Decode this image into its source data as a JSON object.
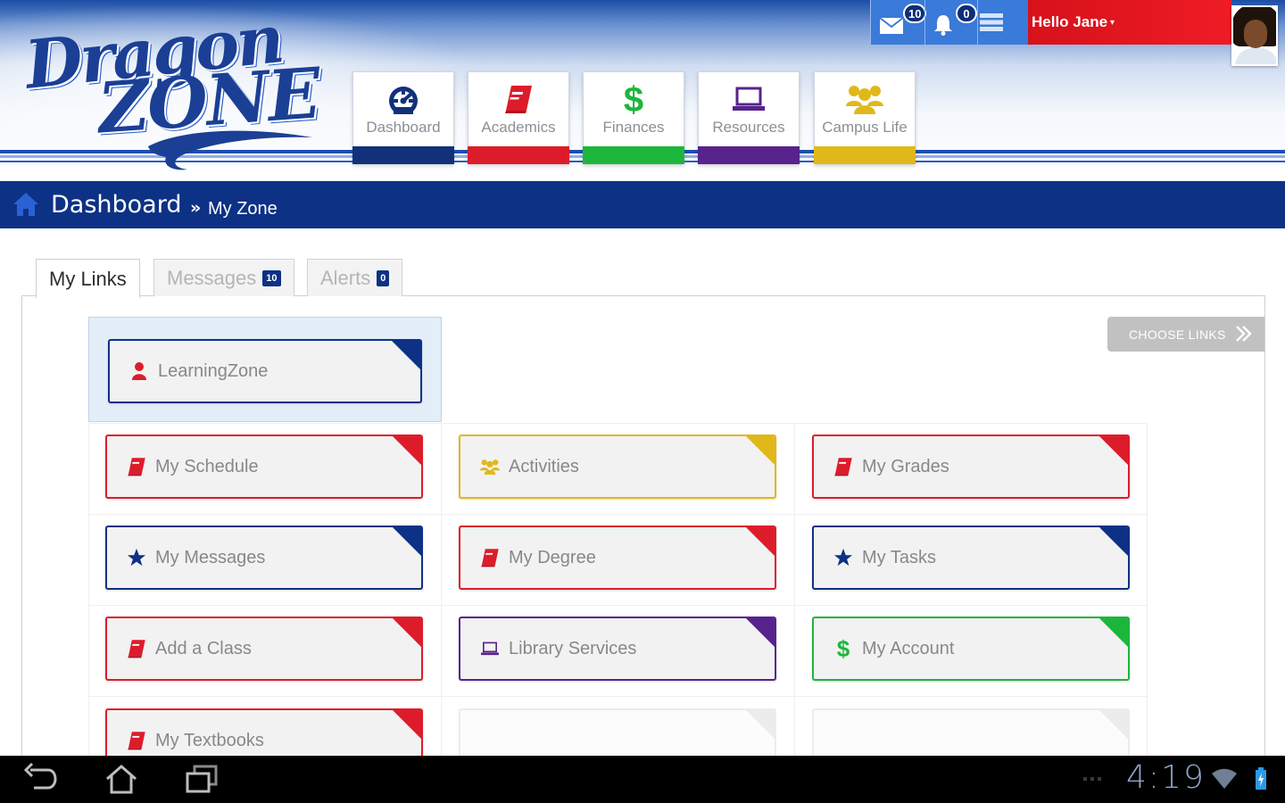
{
  "header": {
    "logo_text_line1": "Dragon",
    "logo_text_line2": "ZONE",
    "messages_count": "10",
    "alerts_count": "0",
    "greeting": "Hello Jane",
    "caret": "▾"
  },
  "nav": [
    {
      "label": "Dashboard",
      "icon": "dashboard-gauge-icon",
      "color": "#12317a"
    },
    {
      "label": "Academics",
      "icon": "book-icon",
      "color": "#dd1c2b"
    },
    {
      "label": "Finances",
      "icon": "dollar-icon",
      "color": "#1db63c"
    },
    {
      "label": "Resources",
      "icon": "laptop-icon",
      "color": "#57238c"
    },
    {
      "label": "Campus Life",
      "icon": "people-icon",
      "color": "#e0b81a"
    }
  ],
  "breadcrumb": {
    "main": "Dashboard",
    "sep": "»",
    "sub": "My Zone"
  },
  "tabs": [
    {
      "label": "My Links",
      "badge": ""
    },
    {
      "label": "Messages",
      "badge": "10"
    },
    {
      "label": "Alerts",
      "badge": "0"
    }
  ],
  "choose_links_label": "CHOOSE LINKS",
  "links": [
    {
      "label": "LearningZone",
      "icon": "person-icon",
      "color": "#0d3185",
      "icon_color": "#dd1c2b"
    },
    {
      "label": "My Schedule",
      "icon": "book-icon",
      "color": "#dd1c2b",
      "icon_color": "#dd1c2b"
    },
    {
      "label": "Activities",
      "icon": "people-icon",
      "color": "#e0b81a",
      "icon_color": "#e0b81a"
    },
    {
      "label": "My Grades",
      "icon": "book-icon",
      "color": "#dd1c2b",
      "icon_color": "#dd1c2b"
    },
    {
      "label": "My Messages",
      "icon": "star-icon",
      "color": "#0d3185",
      "icon_color": "#0d3185"
    },
    {
      "label": "My Degree",
      "icon": "book-icon",
      "color": "#dd1c2b",
      "icon_color": "#dd1c2b"
    },
    {
      "label": "My Tasks",
      "icon": "star-icon",
      "color": "#0d3185",
      "icon_color": "#0d3185"
    },
    {
      "label": "Add a Class",
      "icon": "book-icon",
      "color": "#dd1c2b",
      "icon_color": "#dd1c2b"
    },
    {
      "label": "Library Services",
      "icon": "laptop-icon",
      "color": "#57238c",
      "icon_color": "#57238c"
    },
    {
      "label": "My Account",
      "icon": "dollar-icon",
      "color": "#1db63c",
      "icon_color": "#1db63c"
    },
    {
      "label": "My Textbooks",
      "icon": "book-icon",
      "color": "#dd1c2b",
      "icon_color": "#dd1c2b"
    }
  ],
  "system_bar": {
    "clock": "4:19"
  }
}
